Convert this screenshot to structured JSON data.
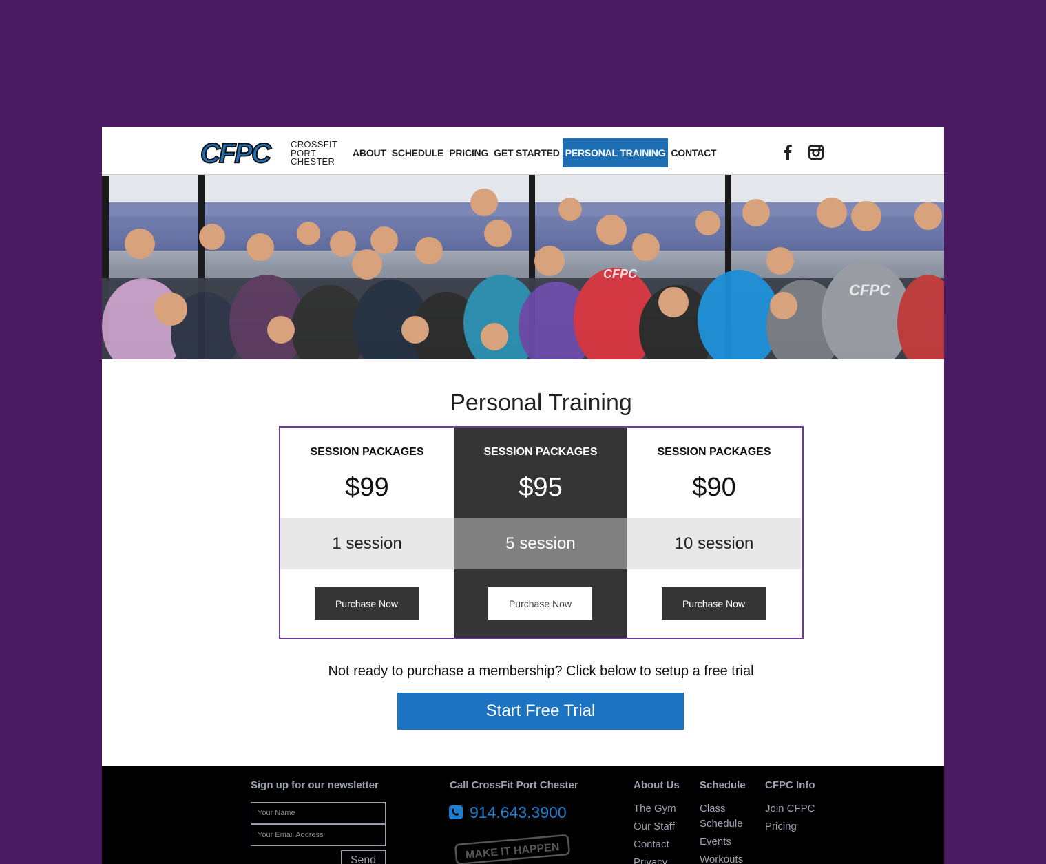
{
  "header": {
    "logo_mark": "CFPC",
    "logo_lines": [
      "CROSSFIT",
      "PORT",
      "CHESTER"
    ],
    "nav": [
      {
        "label": "ABOUT",
        "active": false
      },
      {
        "label": "SCHEDULE",
        "active": false
      },
      {
        "label": "PRICING",
        "active": false
      },
      {
        "label": "GET STARTED",
        "active": false
      },
      {
        "label": "PERSONAL TRAINING",
        "active": true
      },
      {
        "label": "CONTACT",
        "active": false
      }
    ],
    "social_icons": [
      "facebook-icon",
      "instagram-icon"
    ]
  },
  "hero": {
    "subject": "group-photo"
  },
  "section": {
    "title": "Personal Training",
    "plans": [
      {
        "heading": "SESSION PACKAGES",
        "price": "$99",
        "sessions": "1 session",
        "button": "Purchase Now",
        "featured": false
      },
      {
        "heading": "SESSION PACKAGES",
        "price": "$95",
        "sessions": "5 session",
        "button": "Purchase Now",
        "featured": true
      },
      {
        "heading": "SESSION PACKAGES",
        "price": "$90",
        "sessions": "10 session",
        "button": "Purchase Now",
        "featured": false
      }
    ],
    "trial_text": "Not ready to purchase a membership? Click below to setup a free trial",
    "trial_button": "Start Free Trial"
  },
  "footer": {
    "newsletter_heading": "Sign up for our newsletter",
    "name_placeholder": "Your Name",
    "email_placeholder": "Your Email Address",
    "send_label": "Send",
    "call_heading": "Call CrossFit Port Chester",
    "phone": "914.643.3900",
    "stamp": "MAKE IT HAPPEN",
    "columns": [
      {
        "heading": "About Us",
        "links": [
          "The Gym",
          "Our Staff",
          "Contact",
          "Privacy"
        ]
      },
      {
        "heading": "Schedule",
        "links": [
          "Class Schedule",
          "Events",
          "Workouts"
        ]
      },
      {
        "heading": "CFPC Info",
        "links": [
          "Join CFPC",
          "Pricing"
        ]
      }
    ]
  },
  "colors": {
    "background": "#4a1a63",
    "nav_active": "#1f6fb5",
    "pricing_border": "#6b3a9e",
    "featured_dark": "#353535",
    "trial_button": "#1b73c2",
    "phone": "#1e7fd0"
  }
}
